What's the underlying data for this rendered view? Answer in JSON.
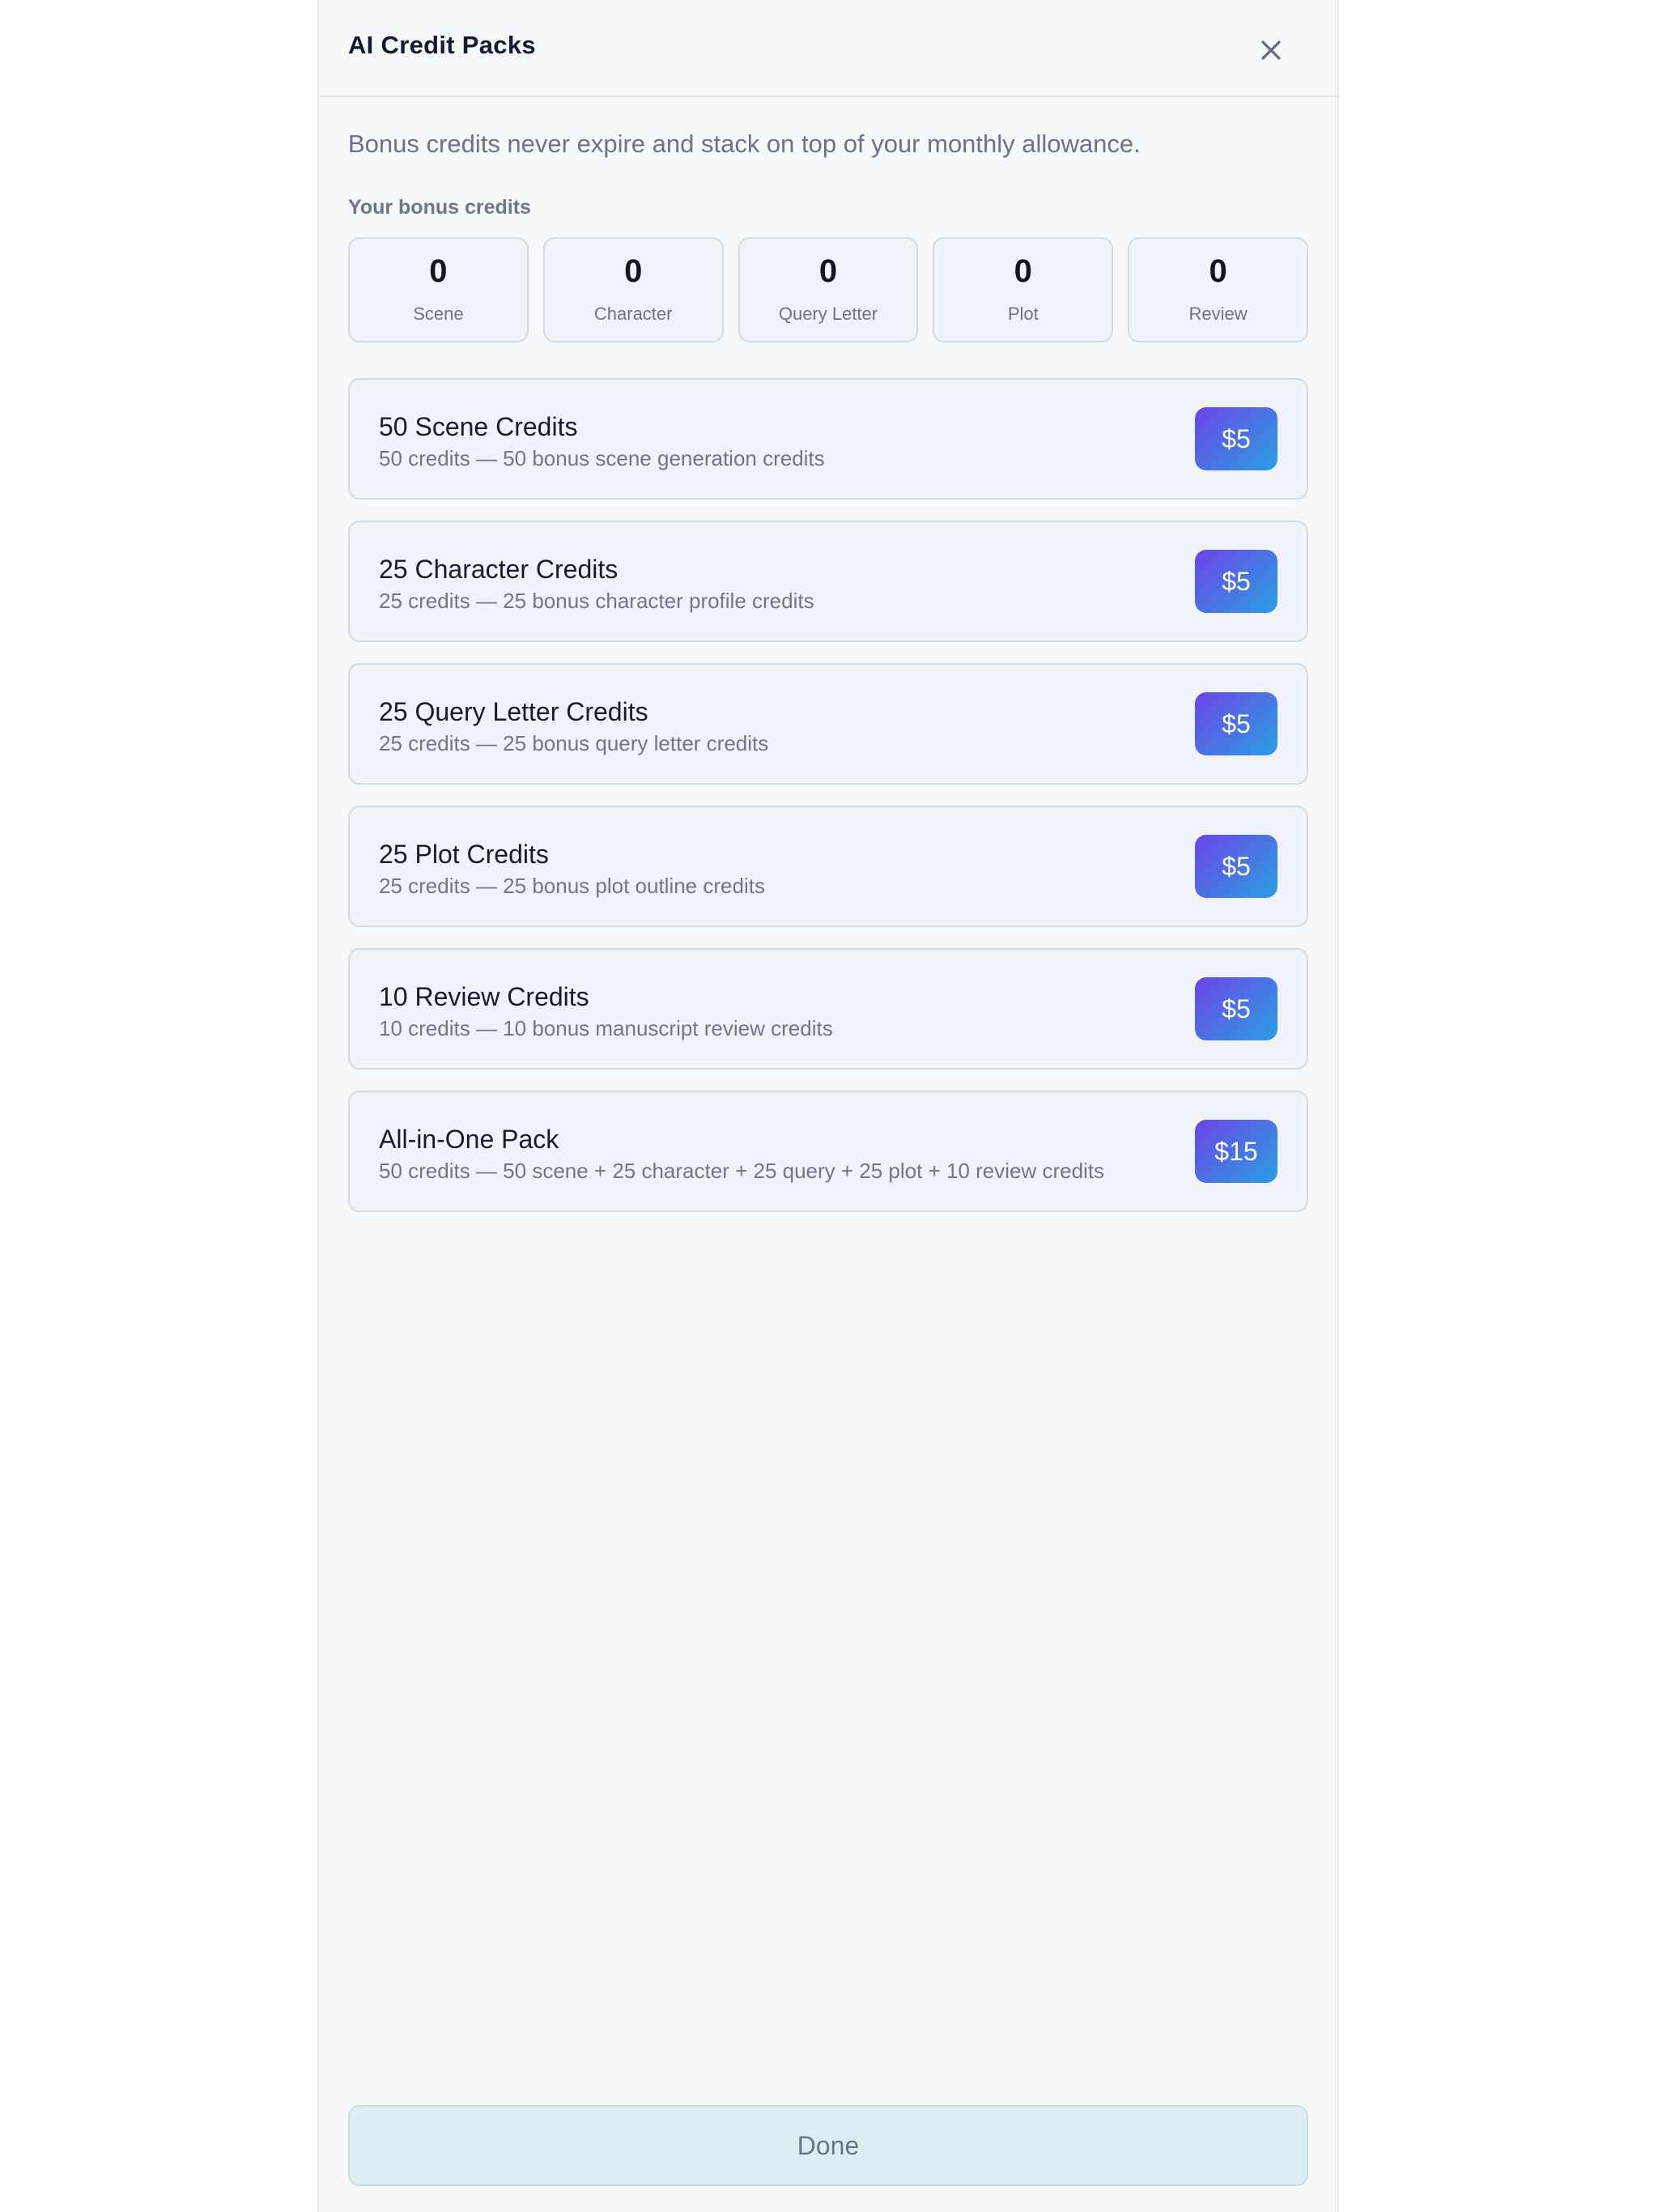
{
  "modal": {
    "title": "AI Credit Packs",
    "close_icon": "close-icon",
    "intro": "Bonus credits never expire and stack on top of your monthly allowance.",
    "bonus_label": "Your bonus credits"
  },
  "stats": [
    {
      "value": "0",
      "label": "Scene"
    },
    {
      "value": "0",
      "label": "Character"
    },
    {
      "value": "0",
      "label": "Query Letter"
    },
    {
      "value": "0",
      "label": "Plot"
    },
    {
      "value": "0",
      "label": "Review"
    }
  ],
  "packs": [
    {
      "name": "50 Scene Credits",
      "description": "50 credits — 50 bonus scene generation credits",
      "price": "$5"
    },
    {
      "name": "25 Character Credits",
      "description": "25 credits — 25 bonus character profile credits",
      "price": "$5"
    },
    {
      "name": "25 Query Letter Credits",
      "description": "25 credits — 25 bonus query letter credits",
      "price": "$5"
    },
    {
      "name": "25 Plot Credits",
      "description": "25 credits — 25 bonus plot outline credits",
      "price": "$5"
    },
    {
      "name": "10 Review Credits",
      "description": "10 credits — 10 bonus manuscript review credits",
      "price": "$5"
    },
    {
      "name": "All-in-One Pack",
      "description": "50 credits — 50 scene + 25 character + 25 query + 25 plot + 10 review credits",
      "price": "$15"
    }
  ],
  "footer": {
    "done_label": "Done"
  },
  "colors": {
    "accent_gradient_start": "#6b44e6",
    "accent_gradient_end": "#2aa0e3",
    "panel_background": "#f7f8f9",
    "card_background": "#f1f3fb",
    "done_background": "#ddeef2"
  }
}
